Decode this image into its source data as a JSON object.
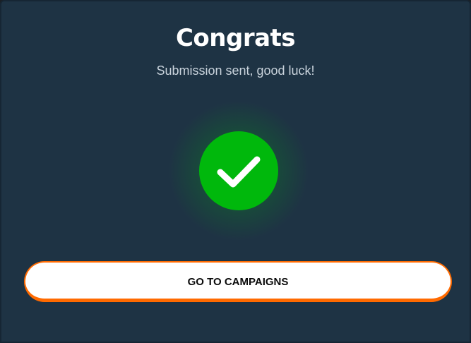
{
  "dialog": {
    "title": "Congrats",
    "subtitle": "Submission sent, good luck!",
    "status_icon": "checkmark-icon",
    "cta_label": "GO TO CAMPAIGNS"
  },
  "colors": {
    "background": "#1e3344",
    "success": "#00b80c",
    "accent": "#ff6a00",
    "button_bg": "#ffffff"
  }
}
